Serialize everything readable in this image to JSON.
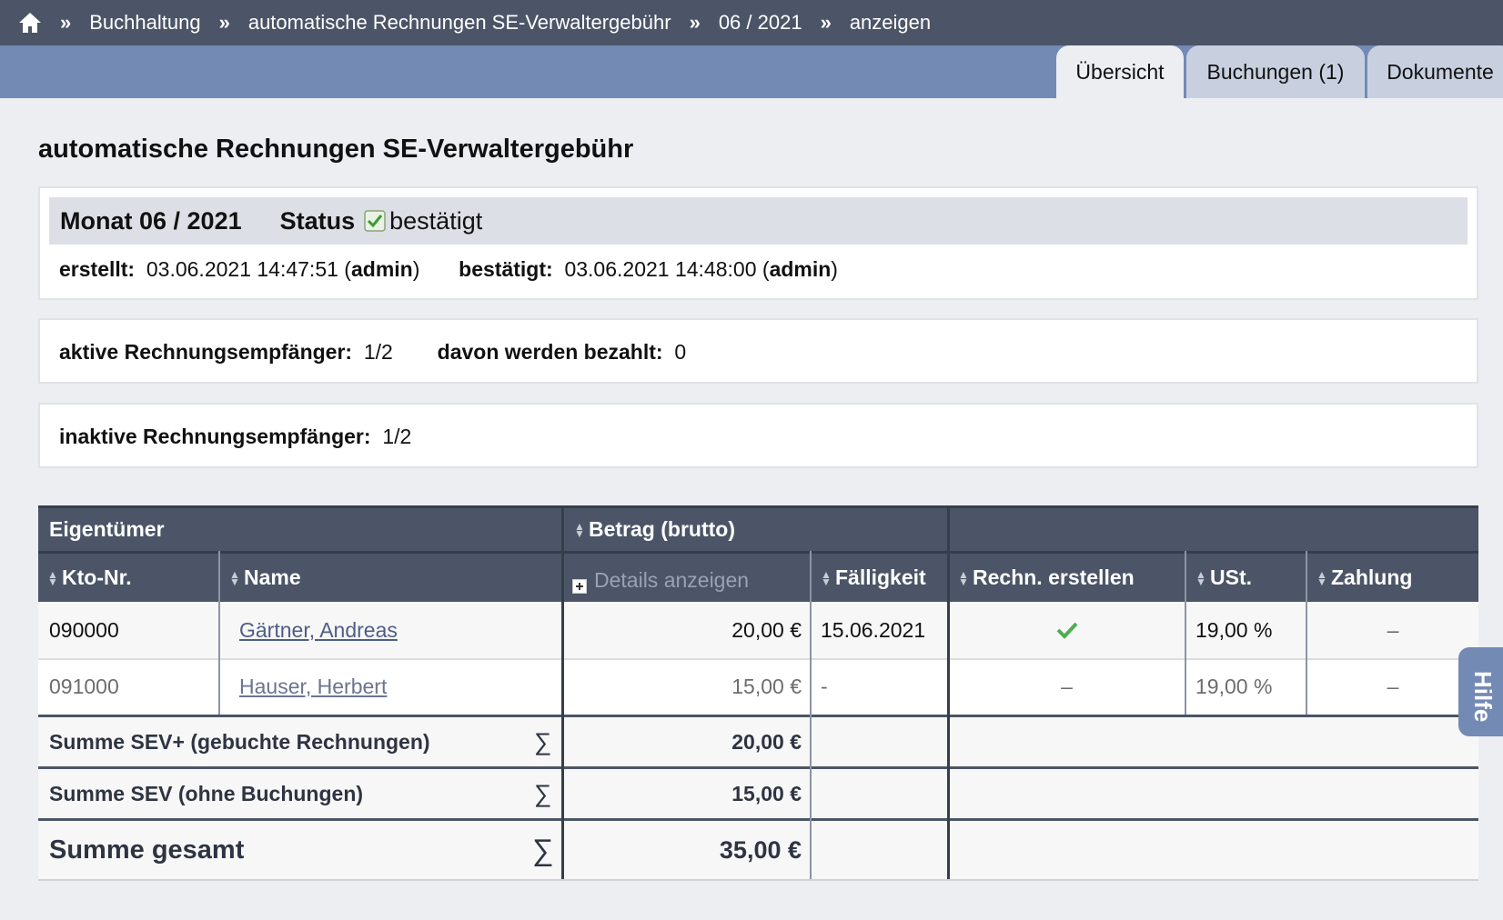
{
  "breadcrumb": {
    "home_icon": "home-icon",
    "separator": "»",
    "items": [
      "Buchhaltung",
      "automatische Rechnungen SE-Verwaltergebühr",
      "06 / 2021",
      "anzeigen"
    ]
  },
  "tabs": [
    {
      "label": "Übersicht",
      "active": true
    },
    {
      "label": "Buchungen (1)",
      "active": false
    },
    {
      "label": "Dokumente",
      "active": false
    }
  ],
  "page_title": "automatische Rechnungen SE-Verwaltergebühr",
  "status": {
    "month_label": "Monat",
    "month_value": "06 / 2021",
    "status_label": "Status",
    "status_icon": "checked-checkbox-icon",
    "status_value": "bestätigt",
    "created_label": "erstellt:",
    "created_value": "03.06.2021 14:47:51",
    "created_user": "admin",
    "confirmed_label": "bestätigt:",
    "confirmed_value": "03.06.2021 14:48:00",
    "confirmed_user": "admin"
  },
  "active": {
    "label": "aktive Rechnungsempfänger:",
    "value": "1/2",
    "paid_label": "davon werden bezahlt:",
    "paid_value": "0"
  },
  "inactive": {
    "label": "inaktive Rechnungsempfänger:",
    "value": "1/2"
  },
  "table": {
    "group_headers": {
      "owner": "Eigentümer",
      "amount": "Betrag (brutto)",
      "rest": ""
    },
    "columns": {
      "account": "Kto-Nr.",
      "name": "Name",
      "details": "Details anzeigen",
      "due": "Fälligkeit",
      "create_invoice": "Rechn. erstellen",
      "vat": "USt.",
      "payment": "Zahlung"
    },
    "rows": [
      {
        "account": "090000",
        "name": "Gärtner, Andreas",
        "amount": "20,00 €",
        "due": "15.06.2021",
        "create_invoice": "check",
        "vat": "19,00 %",
        "payment": "–",
        "active": true
      },
      {
        "account": "091000",
        "name": "Hauser, Herbert",
        "amount": "15,00 €",
        "due": "-",
        "create_invoice": "–",
        "vat": "19,00 %",
        "payment": "–",
        "active": false
      }
    ],
    "sums": [
      {
        "label": "Summe SEV+ (gebuchte Rechnungen)",
        "symbol": "∑",
        "value": "20,00 €"
      },
      {
        "label": "Summe SEV (ohne Buchungen)",
        "symbol": "∑",
        "value": "15,00 €"
      },
      {
        "label": "Summe gesamt",
        "symbol": "∑",
        "value": "35,00 €"
      }
    ]
  },
  "help_tab": "Hilfe",
  "colors": {
    "header_dark": "#4b5567",
    "tab_bar": "#738ab4",
    "link": "#4e5e86",
    "check_green": "#4caf50"
  }
}
